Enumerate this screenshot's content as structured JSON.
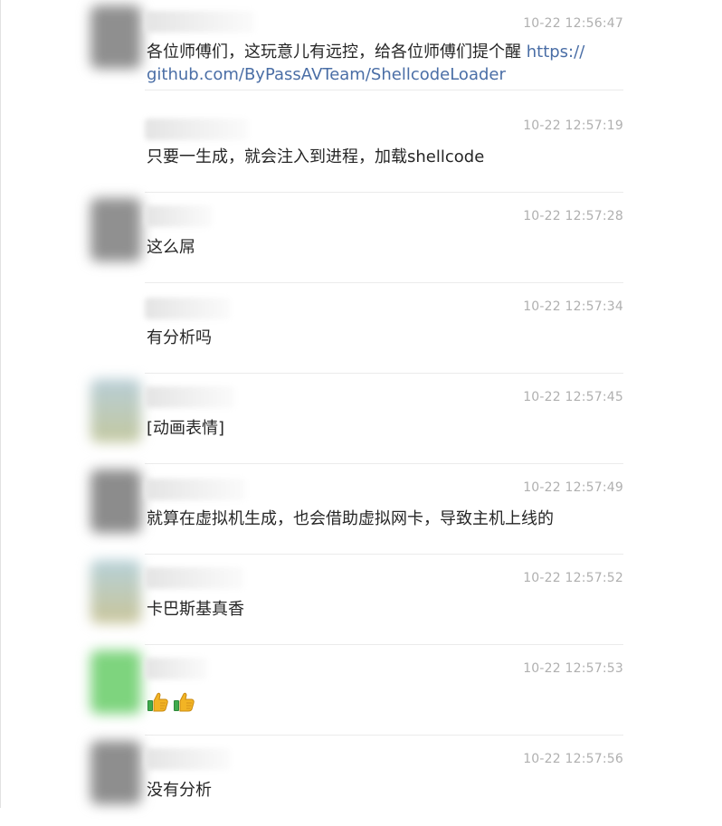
{
  "messages": [
    {
      "time": "10-22 12:56:47",
      "text": "各位师傅们，这玩意儿有远控，给各位师傅们提个醒 ",
      "link": "https://github.com/ByPassAVTeam/ShellcodeLoader",
      "link_line1": "https://",
      "link_line2": "github.com/ByPassAVTeam/ShellcodeLoader",
      "avatar_color": "#8f8f8f"
    },
    {
      "time": "10-22 12:57:19",
      "text": "只要一生成，就会注入到进程，加载shellcode",
      "avatar_color": "#ffffff"
    },
    {
      "time": "10-22 12:57:28",
      "text": "这么屌",
      "avatar_color": "#909090"
    },
    {
      "time": "10-22 12:57:34",
      "text": "有分析吗",
      "avatar_color": "#ffffff"
    },
    {
      "time": "10-22 12:57:45",
      "text": "[动画表情]",
      "avatar_color": "#a9b9a8"
    },
    {
      "time": "10-22 12:57:49",
      "text": "就算在虚拟机生成，也会借助虚拟网卡，导致主机上线的",
      "avatar_color": "#8c8c8c"
    },
    {
      "time": "10-22 12:57:52",
      "text": "卡巴斯基真香",
      "avatar_color": "#a8bab0"
    },
    {
      "time": "10-22 12:57:53",
      "text": "",
      "emoji": [
        "thumbs-up",
        "thumbs-up"
      ],
      "avatar_color": "#7ed47e"
    },
    {
      "time": "10-22 12:57:56",
      "text": "没有分析",
      "avatar_color": "#8e8e8e"
    }
  ]
}
